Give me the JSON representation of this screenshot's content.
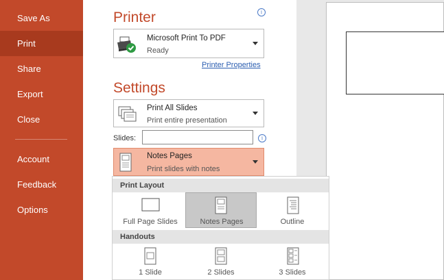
{
  "sidebar": {
    "items": [
      {
        "label": "Save As"
      },
      {
        "label": "Print",
        "active": true
      },
      {
        "label": "Share"
      },
      {
        "label": "Export"
      },
      {
        "label": "Close"
      },
      {
        "label": "Account"
      },
      {
        "label": "Feedback"
      },
      {
        "label": "Options"
      }
    ]
  },
  "printer": {
    "section_title": "Printer",
    "selected_name": "Microsoft Print To PDF",
    "status": "Ready",
    "properties_link": "Printer Properties",
    "info_icon": "i"
  },
  "settings": {
    "section_title": "Settings",
    "range_title": "Print All Slides",
    "range_sub": "Print entire presentation",
    "slides_label": "Slides:",
    "slides_value": "",
    "layout_title": "Notes Pages",
    "layout_sub": "Print slides with notes",
    "info_icon": "i"
  },
  "flyout": {
    "print_layout_header": "Print Layout",
    "layout_options": [
      {
        "label": "Full Page Slides"
      },
      {
        "label": "Notes Pages",
        "selected": true
      },
      {
        "label": "Outline"
      }
    ],
    "handouts_header": "Handouts",
    "handout_options": [
      {
        "label": "1 Slide"
      },
      {
        "label": "2 Slides"
      },
      {
        "label": "3 Slides"
      }
    ]
  },
  "colors": {
    "sidebar": "#c2492a",
    "sidebar_active": "#a83a1e",
    "accent_title": "#c2492a",
    "selected_dropdown": "#f5b7a1",
    "link": "#2a5db0"
  }
}
